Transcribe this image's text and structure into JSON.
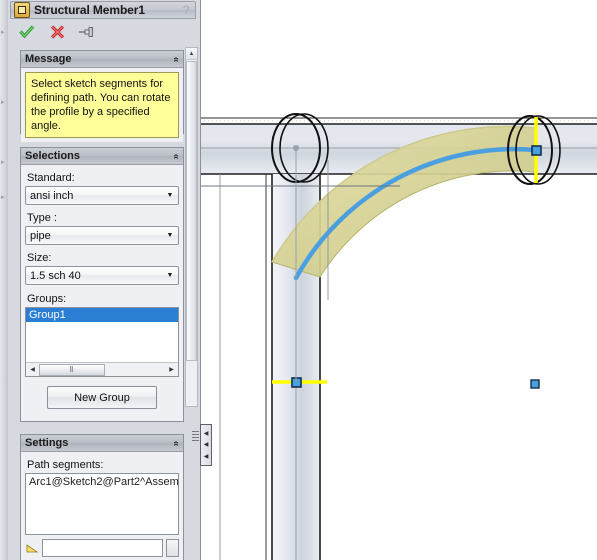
{
  "window": {
    "title": "Structural Member1",
    "title_icon": "structural-member-icon",
    "help_glyph": "?"
  },
  "toolbar": {
    "ok_label": "✔",
    "ok_name": "green-check-icon",
    "cancel_label": "✘",
    "cancel_name": "red-x-icon",
    "pin_name": "pushpin-icon"
  },
  "sections": {
    "message": {
      "title": "Message",
      "collapse_glyph": "«",
      "text": "Select sketch segments for defining path. You can rotate the profile by a specified angle."
    },
    "selections": {
      "title": "Selections",
      "collapse_glyph": "«",
      "standard_label": "Standard:",
      "standard_value": "ansi inch",
      "type_label": "Type :",
      "type_value": "pipe",
      "size_label": "Size:",
      "size_value": "1.5 sch 40",
      "groups_label": "Groups:",
      "groups_items": [
        "Group1"
      ],
      "new_group_label": "New Group",
      "dropdown_glyph": "▼",
      "hscroll_left_glyph": "◀",
      "hscroll_right_glyph": "▶",
      "hscroll_grip_glyph": "Ⅱ"
    },
    "settings": {
      "title": "Settings",
      "collapse_glyph": "«",
      "path_segments_label": "Path segments:",
      "path_segments_items": [
        "Arc1@Sketch2@Part2^Assem"
      ]
    }
  },
  "scrollbar": {
    "up_glyph": "▲"
  },
  "splitter": {
    "collapse_glyph": "◀"
  },
  "viewport": {
    "name": "3d-graphics-area",
    "background": "#ffffff",
    "pipe_fill_light": "#eef0f4",
    "pipe_fill_mid": "#d4d9e1",
    "pipe_outline": "#1d1d1d",
    "preview_fill": "#d8d498",
    "preview_edge": "#b7b46e",
    "centerline_color": "#4a9fe0",
    "selected_edge_color": "#ffff00",
    "handle_fill": "#4a9fe0",
    "handle_stroke": "#11304f",
    "sketch_line_color": "#7a7f87"
  }
}
